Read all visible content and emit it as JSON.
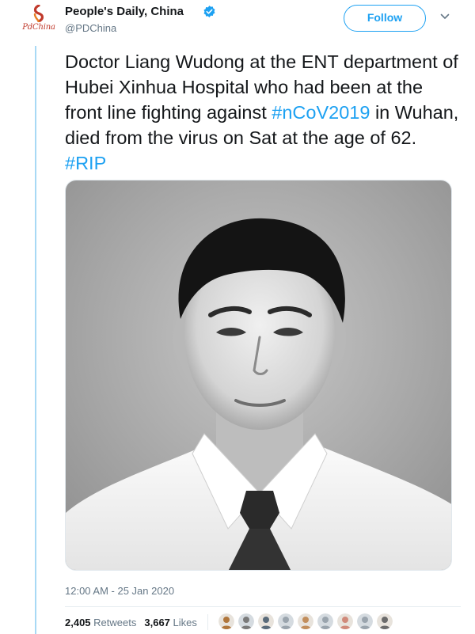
{
  "author": {
    "name": "People's Daily, China",
    "handle": "@PDChina",
    "avatar_text": "PdChina",
    "verified": true,
    "avatar_icon": "pdchina-logo"
  },
  "actions": {
    "follow_label": "Follow",
    "menu_icon": "chevron-down-icon"
  },
  "tweet": {
    "segments": [
      {
        "text": "Doctor Liang Wudong at the ENT department of Hubei Xinhua Hospital who had been at the front line fighting against ",
        "type": "text"
      },
      {
        "text": "#nCoV2019",
        "type": "hashtag"
      },
      {
        "text": " in Wuhan, died from the virus on Sat at the age of 62. ",
        "type": "text"
      },
      {
        "text": "#RIP",
        "type": "hashtag"
      }
    ],
    "photo_description": "black-and-white portrait"
  },
  "meta": {
    "timestamp": "12:00 AM - 25 Jan 2020",
    "retweets_count": "2,405",
    "retweets_label": "Retweets",
    "likes_count": "3,667",
    "likes_label": "Likes",
    "liker_count": 9
  },
  "colors": {
    "accent": "#1da1f2",
    "text": "#14171a",
    "muted": "#657786",
    "thread_line": "#a8d9f5"
  }
}
